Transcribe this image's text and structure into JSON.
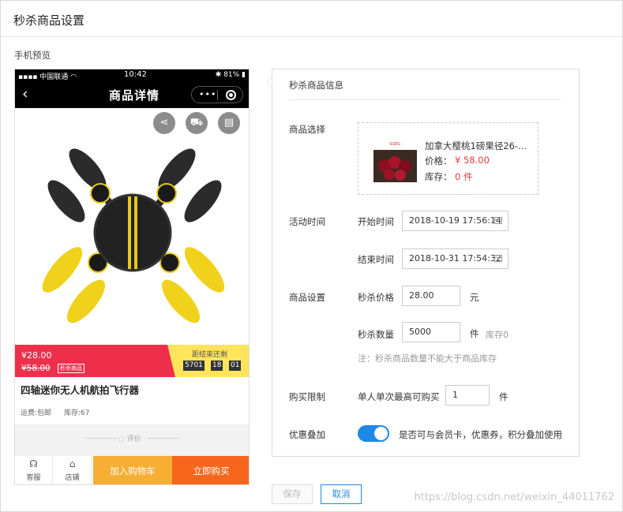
{
  "page": {
    "title": "秒杀商品设置",
    "preview_label": "手机预览"
  },
  "phone": {
    "carrier": "中国联通",
    "time": "10:42",
    "battery": "81%",
    "nav_title": "商品详情",
    "flash": {
      "price": "¥28.00",
      "old_price": "¥58.00",
      "tag": "秒杀商品",
      "countdown_label": "距结束还剩",
      "cd_days": "5701",
      "cd_hours": "18",
      "cd_minutes": "01"
    },
    "product_name": "四轴迷你无人机航拍飞行器",
    "shipping": "运费:包邮",
    "stock": "库存:67",
    "review": "评价",
    "bottom": {
      "service": "客服",
      "store": "店铺",
      "add_cart": "加入购物车",
      "buy_now": "立即购买"
    }
  },
  "form": {
    "section_title": "秒杀商品信息",
    "goods_label": "商品选择",
    "goods": {
      "name": "加拿大樱桃1磅果径26-...",
      "price_label": "价格：",
      "price": "¥ 58.00",
      "stock_label": "库存：",
      "stock": "0 件",
      "thumb_text": "SGEG"
    },
    "activity_time_label": "活动时间",
    "start_label": "开始时间",
    "start_value": "2018-10-19 17:56:14",
    "end_label": "结束时间",
    "end_value": "2018-10-31 17:54:32",
    "goods_setting_label": "商品设置",
    "flash_price_label": "秒杀价格",
    "flash_price_value": "28.00",
    "price_unit": "元",
    "flash_qty_label": "秒杀数量",
    "flash_qty_value": "5000",
    "qty_unit": "件",
    "stock_hint": "库存0",
    "note": "注：秒杀商品数量不能大于商品库存",
    "limit_label": "购买限制",
    "limit_text": "单人单次最高可购买",
    "limit_value": "1",
    "limit_unit": "件",
    "discount_label": "优惠叠加",
    "discount_text": "是否可与会员卡，优惠券，积分叠加使用",
    "discount_enabled": true
  },
  "actions": {
    "save": "保存",
    "cancel": "取消"
  },
  "watermark": "https://blog.csdn.net/weixin_44011762",
  "colors": {
    "accent": "#1e88e5",
    "flash_red": "#ee2f4c",
    "flash_yellow": "#ffe45c",
    "cart": "#f6ae33",
    "buy": "#f6661d",
    "price_red": "#e4393c"
  }
}
